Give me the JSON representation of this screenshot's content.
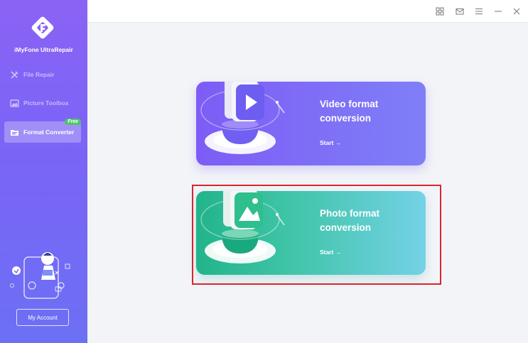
{
  "sidebar": {
    "brand": "iMyFone UltraRepair",
    "items": [
      {
        "label": "File Repair",
        "icon": "tools-icon",
        "active": false
      },
      {
        "label": "Picture Toolbox",
        "icon": "image-icon",
        "active": false
      },
      {
        "label": "Format Converter",
        "icon": "folder-icon",
        "active": true,
        "badge": "Free"
      }
    ],
    "account_label": "My Account"
  },
  "titlebar": {
    "icons": [
      "grid-icon",
      "mail-icon",
      "menu-icon",
      "minimize-icon",
      "close-icon"
    ]
  },
  "cards": {
    "video": {
      "title_line1": "Video format",
      "title_line2": "conversion",
      "start": "Start →"
    },
    "photo": {
      "title_line1": "Photo format",
      "title_line2": "conversion",
      "start": "Start →"
    }
  },
  "colors": {
    "sidebar_top": "#8a63f5",
    "sidebar_bottom": "#6c70f4",
    "highlight": "#d8262c",
    "free_badge": "#4fc46a"
  }
}
